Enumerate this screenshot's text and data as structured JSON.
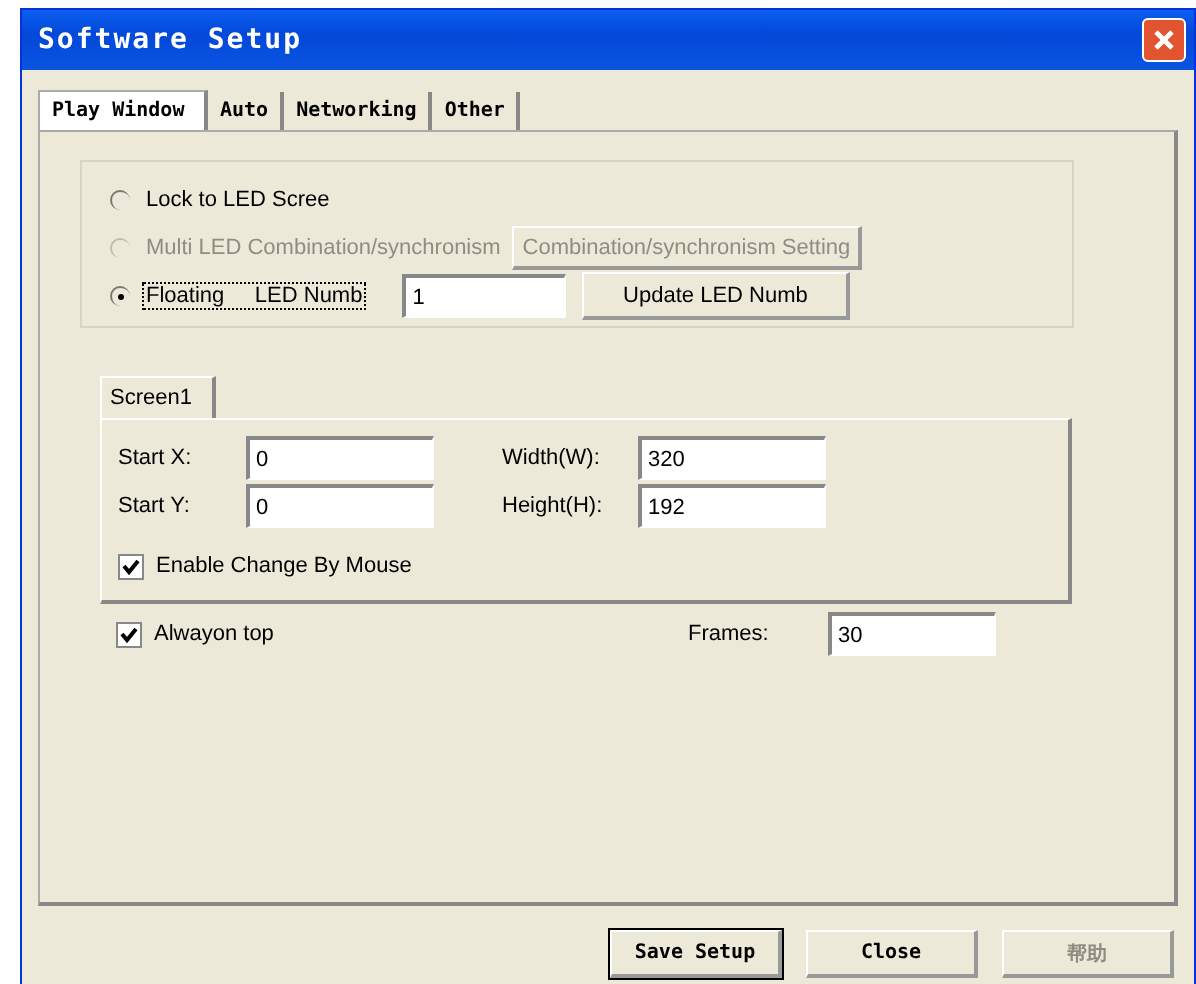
{
  "window": {
    "title": "Software Setup"
  },
  "tabs": [
    {
      "label": "Play Window",
      "selected": true
    },
    {
      "label": "Auto",
      "selected": false
    },
    {
      "label": "Networking",
      "selected": false
    },
    {
      "label": "Other",
      "selected": false
    }
  ],
  "mode_options": [
    {
      "label": "Lock to LED Scree",
      "selected": false,
      "disabled": false
    },
    {
      "label": "Multi LED Combination/synchronism",
      "selected": false,
      "disabled": true
    },
    {
      "label": "Floating     LED Numb",
      "selected": true,
      "disabled": false
    }
  ],
  "combination_button": {
    "label": "Combination/synchronism Setting",
    "disabled": true
  },
  "led_number": {
    "value": "1"
  },
  "update_button": {
    "label": "Update LED Numb"
  },
  "screen_tabs": [
    {
      "label": "Screen1",
      "selected": true
    }
  ],
  "fields": [
    {
      "label": "Start X:",
      "value": "0"
    },
    {
      "label": "Width(W):",
      "value": "320"
    },
    {
      "label": "Start Y:",
      "value": "0"
    },
    {
      "label": "Height(H):",
      "value": "192"
    }
  ],
  "enable_change_by_mouse": {
    "label": "Enable Change By Mouse",
    "checked": true
  },
  "always_on_top": {
    "label": "Alwayon top",
    "checked": true
  },
  "frames": {
    "label": "Frames:",
    "value": "30"
  },
  "buttons": [
    {
      "label": "Save Setup",
      "disabled": false,
      "default": true
    },
    {
      "label": "Close",
      "disabled": false,
      "default": false
    },
    {
      "label": "帮助",
      "disabled": true,
      "default": false
    }
  ]
}
